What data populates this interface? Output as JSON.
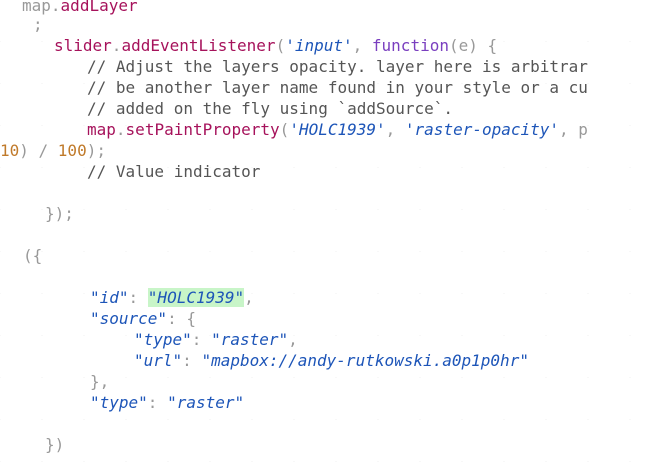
{
  "code": {
    "l1_obj": "map",
    "l1_dot": ".",
    "l1_fn": "addLayer",
    "l2_semi": ";",
    "l3_obj": "slider",
    "l3_dot": ".",
    "l3_fn": "addEventListener",
    "l3_open": "(",
    "l3_str": "'input'",
    "l3_comma": ", ",
    "l3_kw": "function",
    "l3_params": "(e) {",
    "l4_comment": "// Adjust the layers opacity. layer here is arbitrar",
    "l5_comment": "// be another layer name found in your style or a cu",
    "l6_comment": "// added on the fly using `addSource`.",
    "l7_obj": "map",
    "l7_dot": ".",
    "l7_fn": "setPaintProperty",
    "l7_open": "(",
    "l7_str1": "'HOLC1939'",
    "l7_comma": ", ",
    "l7_str2": "'raster-opacity'",
    "l7_tail": ", p",
    "l8_num1": "10",
    "l8_close": ") / ",
    "l8_num2": "100",
    "l8_end": ");",
    "l9_comment": "// Value indicator",
    "l10_close": "});",
    "l11_open": "({",
    "l12_key_id": "\"id\"",
    "l12_colon": ": ",
    "l12_val_id": "\"HOLC1939\"",
    "l12_comma": ",",
    "l13_key_source": "\"source\"",
    "l13_colon": ": {",
    "l14_key_type": "\"type\"",
    "l14_colon": ": ",
    "l14_val": "\"raster\"",
    "l14_comma": ",",
    "l15_key_url": "\"url\"",
    "l15_colon": ": ",
    "l15_val": "\"mapbox://andy-rutkowski.a0p1p0hr\"",
    "l16_close": "},",
    "l17_key_type": "\"type\"",
    "l17_colon": ": ",
    "l17_val": "\"raster\"",
    "l18_close": "})"
  },
  "colors": {
    "function": "#a6125b",
    "keyword": "#7a3fbf",
    "string": "#1d55b8",
    "number": "#c07a2a",
    "comment": "#555555",
    "punctuation": "#999999",
    "highlight": "#c8f5c8"
  }
}
